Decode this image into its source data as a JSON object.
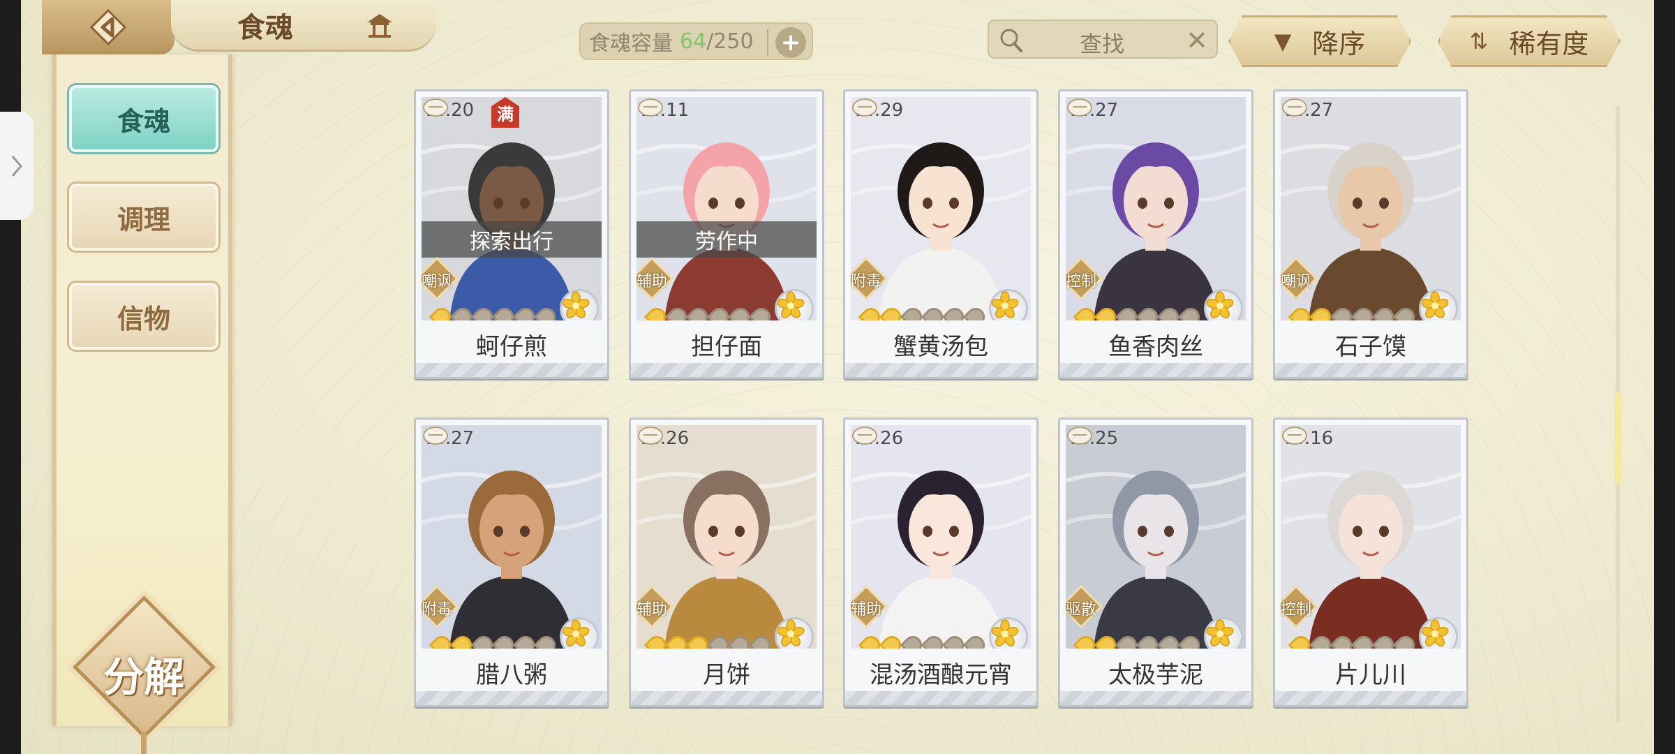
{
  "header": {
    "title": "食魂",
    "back_icon": "back-arrow-icon",
    "home_icon": "pavilion-icon"
  },
  "capacity": {
    "label": "食魂容量",
    "used": "64",
    "separator": "/",
    "max": "250",
    "add_label": "+"
  },
  "search": {
    "placeholder": "查找",
    "clear_label": "✕"
  },
  "sort": {
    "order_label": "降序",
    "order_icon": "▼",
    "field_label": "稀有度",
    "field_icon": "⇅"
  },
  "sidebar": {
    "items": [
      {
        "label": "食魂",
        "active": true
      },
      {
        "label": "调理",
        "active": false
      },
      {
        "label": "信物",
        "active": false
      }
    ],
    "decompose_label": "分解"
  },
  "cards": [
    {
      "level": "Lv.20",
      "full_badge": "满",
      "status": "探索出行",
      "role": "嘲讽",
      "stars_on": 1,
      "name": "蚵仔煎",
      "skin": "#7a5a45",
      "hair": "#3a3a3a",
      "bg": "#d8d9dd",
      "outfit": "#3b5aa8"
    },
    {
      "level": "Lv.11",
      "status": "劳作中",
      "role": "辅助",
      "stars_on": 1,
      "name": "担仔面",
      "skin": "#f6dccc",
      "hair": "#f4a3a8",
      "bg": "#dfe2ea",
      "outfit": "#8c3b30"
    },
    {
      "level": "Lv.29",
      "role": "附毒",
      "stars_on": 2,
      "name": "蟹黄汤包",
      "skin": "#f8e2d2",
      "hair": "#1f1a18",
      "bg": "#e6e7ef",
      "outfit": "#f2f2f0"
    },
    {
      "level": "Lv.27",
      "role": "控制",
      "stars_on": 2,
      "name": "鱼香肉丝",
      "skin": "#f3ddd2",
      "hair": "#6b4aa6",
      "bg": "#d9dbe6",
      "outfit": "#3a3340"
    },
    {
      "level": "Lv.27",
      "role": "嘲讽",
      "stars_on": 2,
      "name": "石子馍",
      "skin": "#e8c8a8",
      "hair": "#d8d2c8",
      "bg": "#dcdde2",
      "outfit": "#6a4a2e"
    },
    {
      "level": "Lv.27",
      "role": "附毒",
      "stars_on": 2,
      "name": "腊八粥",
      "skin": "#d6a27a",
      "hair": "#9a6a3a",
      "bg": "#d4d9e6",
      "outfit": "#2e2e34"
    },
    {
      "level": "Lv.26",
      "role": "辅助",
      "stars_on": 3,
      "name": "月饼",
      "skin": "#f6dccc",
      "hair": "#8a7060",
      "bg": "#e4ddd0",
      "outfit": "#b98a3e"
    },
    {
      "level": "Lv.26",
      "role": "辅助",
      "stars_on": 2,
      "name": "混汤酒酿元宵",
      "skin": "#fae6da",
      "hair": "#2a2230",
      "bg": "#e4e5ee",
      "outfit": "#f4f2f2"
    },
    {
      "level": "Lv.25",
      "role": "驱散",
      "stars_on": 2,
      "name": "太极芋泥",
      "skin": "#e8e4e8",
      "hair": "#8f98a4",
      "bg": "#c8ccd4",
      "outfit": "#3a3a44"
    },
    {
      "level": "Lv.16",
      "role": "控制",
      "stars_on": 1,
      "name": "片儿川",
      "skin": "#f5e2d8",
      "hair": "#dcd8d6",
      "bg": "#e0e2e8",
      "outfit": "#7a2e22"
    }
  ],
  "colors": {
    "accent_teal": "#7fd2c4",
    "gold": "#c59d5a",
    "star_on": "#f2c94c",
    "star_off": "#b5aa98",
    "capacity_used": "#7cc76a"
  }
}
